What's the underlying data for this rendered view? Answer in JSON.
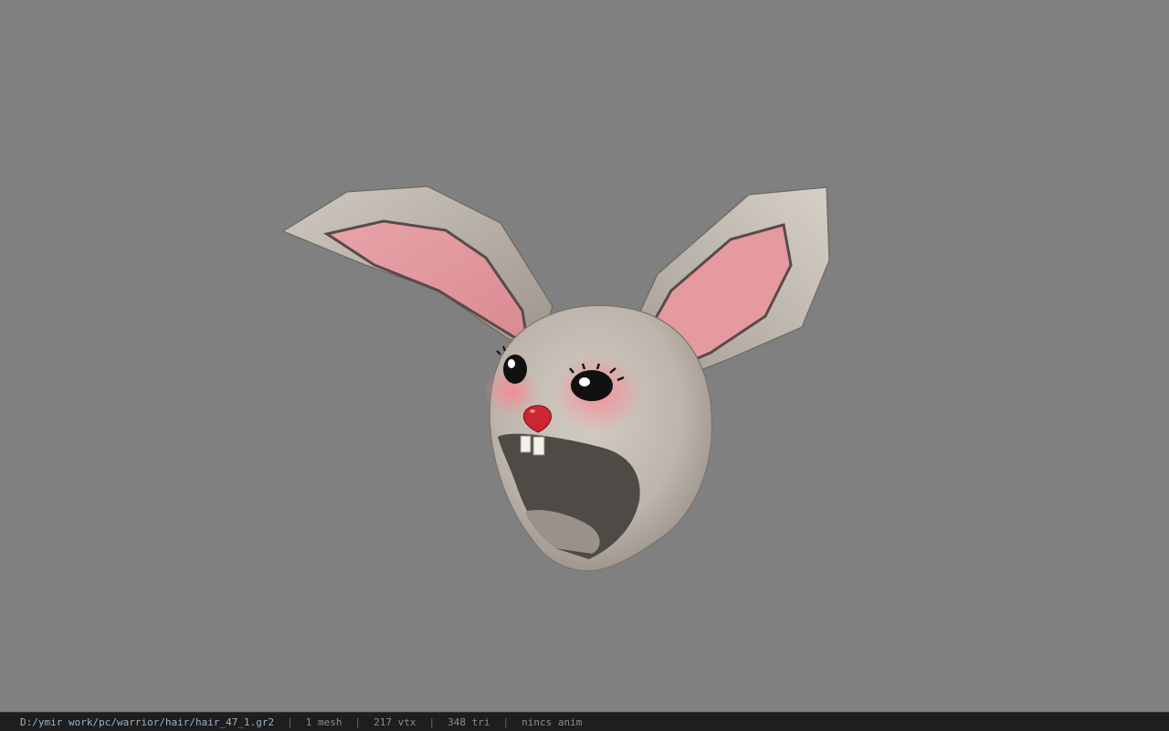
{
  "viewport": {
    "background_color": "#808080",
    "model": {
      "subject": "bunny-hat",
      "fur_color": "#c2bab1",
      "ear_inner_color": "#e69aa0",
      "nose_color": "#cc2630",
      "cheek_color": "#f28c96"
    }
  },
  "statusbar": {
    "file_path": "D:/ymir work/pc/warrior/hair/hair_47_1.gr2",
    "separator": "|",
    "mesh_count": "1 mesh",
    "vertex_count": "217 vtx",
    "triangle_count": "348 tri",
    "anim_status": "nincs anim"
  }
}
